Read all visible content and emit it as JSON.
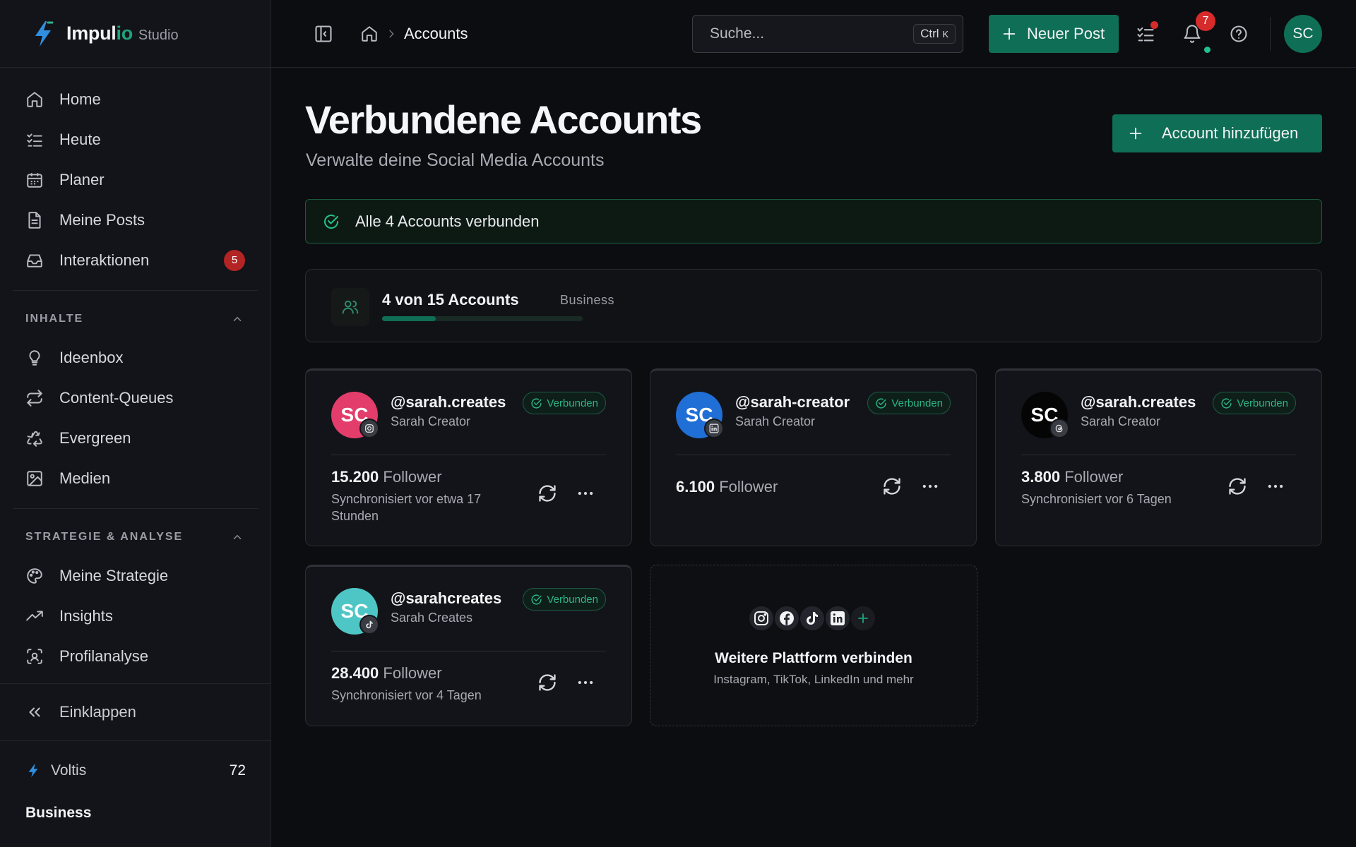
{
  "app": {
    "name_main": "Impul",
    "name_accent": "io",
    "name_suffix": "Studio"
  },
  "sidebar": {
    "main_items": [
      {
        "label": "Home",
        "icon": "home-icon"
      },
      {
        "label": "Heute",
        "icon": "checklist-icon"
      },
      {
        "label": "Planer",
        "icon": "calendar-icon"
      },
      {
        "label": "Meine Posts",
        "icon": "document-icon"
      },
      {
        "label": "Interaktionen",
        "icon": "inbox-icon",
        "badge": "5"
      }
    ],
    "section_content": {
      "title": "INHALTE",
      "items": [
        {
          "label": "Ideenbox",
          "icon": "lightbulb-icon"
        },
        {
          "label": "Content-Queues",
          "icon": "repeat-icon"
        },
        {
          "label": "Evergreen",
          "icon": "recycle-icon"
        },
        {
          "label": "Medien",
          "icon": "image-icon"
        }
      ]
    },
    "section_strategy": {
      "title": "STRATEGIE & ANALYSE",
      "items": [
        {
          "label": "Meine Strategie",
          "icon": "palette-icon"
        },
        {
          "label": "Insights",
          "icon": "trending-up-icon"
        },
        {
          "label": "Profilanalyse",
          "icon": "scan-user-icon"
        }
      ]
    },
    "collapse_label": "Einklappen",
    "credits_label": "Voltis",
    "credits_value": "72",
    "plan_label": "Business"
  },
  "topbar": {
    "breadcrumb_current": "Accounts",
    "search_placeholder": "Suche...",
    "search_shortcut_ctrl": "Ctrl",
    "search_shortcut_key": "K",
    "new_post_label": "Neuer Post",
    "notification_count": "7",
    "user_initials": "SC"
  },
  "page": {
    "title": "Verbundene Accounts",
    "subtitle": "Verwalte deine Social Media Accounts",
    "add_account_label": "Account hinzufügen",
    "success_message": "Alle 4 Accounts verbunden",
    "quota_text": "4 von 15 Accounts",
    "quota_plan": "Business",
    "quota_fraction": 0.2667
  },
  "accounts": [
    {
      "initials": "SC",
      "handle": "@sarah.creates",
      "name": "Sarah Creator",
      "status": "Verbunden",
      "followers_value": "15.200",
      "followers_label": "Follower",
      "sync": "Synchronisiert vor etwa 17 Stunden",
      "platform": "instagram-icon",
      "avatar_color": "#e23d6b"
    },
    {
      "initials": "SC",
      "handle": "@sarah-creator",
      "name": "Sarah Creator",
      "status": "Verbunden",
      "followers_value": "6.100",
      "followers_label": "Follower",
      "sync": "",
      "platform": "linkedin-icon",
      "avatar_color": "#1f6fd6"
    },
    {
      "initials": "SC",
      "handle": "@sarah.creates",
      "name": "Sarah Creator",
      "status": "Verbunden",
      "followers_value": "3.800",
      "followers_label": "Follower",
      "sync": "Synchronisiert vor 6 Tagen",
      "platform": "threads-icon",
      "avatar_color": "#050505"
    },
    {
      "initials": "SC",
      "handle": "@sarahcreates",
      "name": "Sarah Creates",
      "status": "Verbunden",
      "followers_value": "28.400",
      "followers_label": "Follower",
      "sync": "Synchronisiert vor 4 Tagen",
      "platform": "tiktok-icon",
      "avatar_color": "#4fc6c6"
    }
  ],
  "add_platform": {
    "title": "Weitere Plattform verbinden",
    "subtitle": "Instagram, TikTok, LinkedIn und mehr",
    "icons": [
      "instagram-icon",
      "facebook-icon",
      "tiktok-icon",
      "linkedin-icon",
      "plus-icon"
    ]
  },
  "colors": {
    "accent": "#0f6e56",
    "success": "#22c08a",
    "danger": "#d62b2b"
  }
}
